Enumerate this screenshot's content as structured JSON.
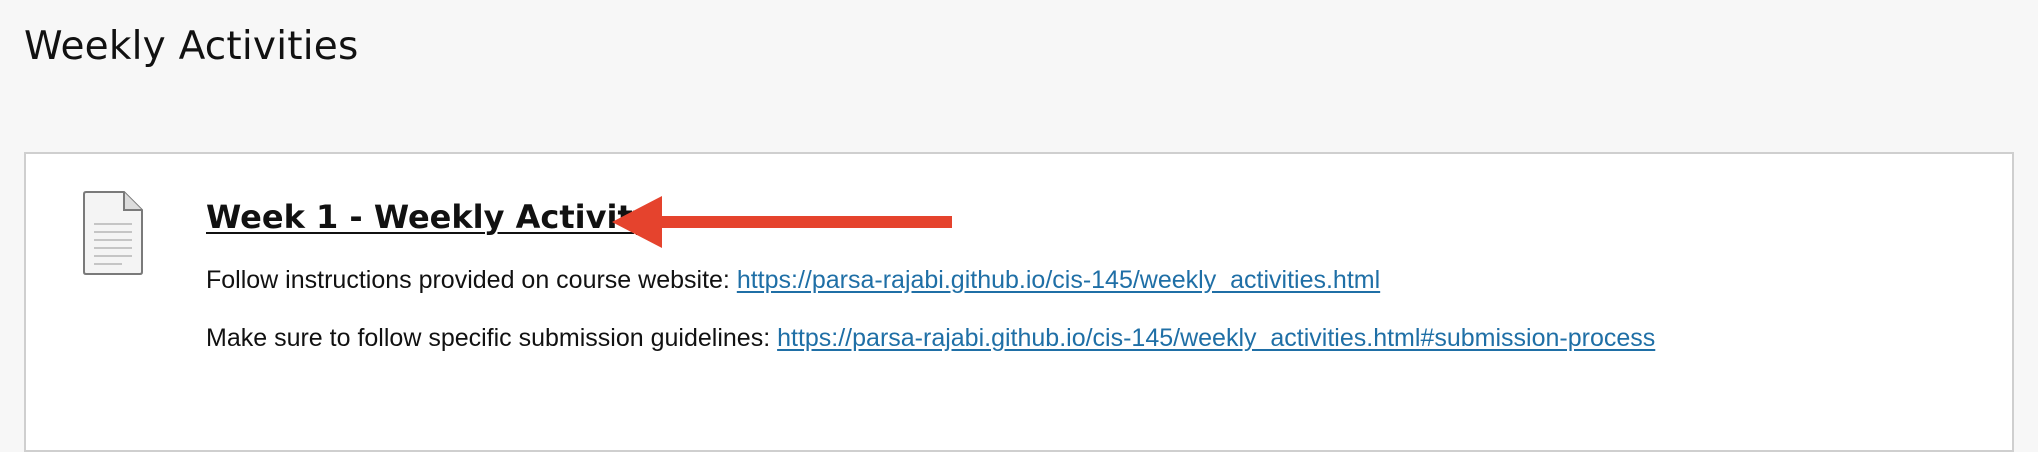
{
  "page": {
    "title": "Weekly Activities"
  },
  "item": {
    "icon": "document-icon",
    "title": "Week 1 - Weekly Activity",
    "instructions_label": "Follow instructions provided on course website: ",
    "instructions_link": "https://parsa-rajabi.github.io/cis-145/weekly_activities.html",
    "submission_label": "Make sure to follow specific submission guidelines: ",
    "submission_link": "https://parsa-rajabi.github.io/cis-145/weekly_activities.html#submission-process"
  },
  "annotation": {
    "icon": "red-arrow-left-icon",
    "color": "#e5432d"
  },
  "colors": {
    "link": "#1f6fa6",
    "background": "#f7f7f7",
    "card": "#ffffff"
  }
}
